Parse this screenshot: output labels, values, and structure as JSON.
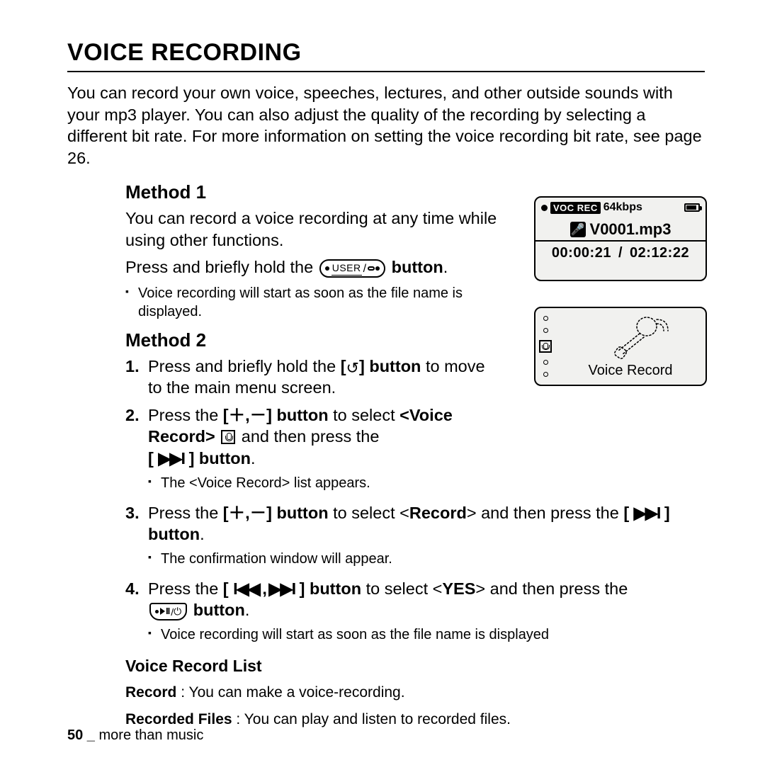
{
  "title": "VOICE RECORDING",
  "intro": "You can record your own voice, speeches, lectures, and other outside sounds with your mp3 player. You can also adjust the quality of the recording by selecting a different bit rate. For more information on setting the voice recording bit rate, see page 26.",
  "method1": {
    "heading": "Method 1",
    "p1": "You can record a voice recording at any time while using other functions.",
    "p2a": "Press and briefly hold the ",
    "p2b": " button",
    "p2c": ".",
    "bullet": "Voice recording will start as soon as the file name is displayed.",
    "user_btn_label": "USER"
  },
  "method2": {
    "heading": "Method 2",
    "s1a": "Press and briefly hold the ",
    "s1b": "[",
    "s1c": "] button",
    "s1d": " to move to the main menu screen.",
    "back_glyph": "↺",
    "s2a": "Press the ",
    "s2b": "[＋,－] button",
    "s2c": " to select ",
    "s2d": "<Voice Record>",
    "s2e": " and then press the ",
    "s2f": "[ ",
    "s2g": " ] button",
    "s2h": ".",
    "ff_glyph": "▶▶I",
    "s2_bullet": "The <Voice Record> list appears.",
    "s3a": "Press the ",
    "s3b": "[＋,－] button",
    "s3c": " to select <",
    "s3d": "Record",
    "s3e": "> and then press the ",
    "s3f": "[ ",
    "s3g": " ] button",
    "s3h": ".",
    "s3_bullet": "The confirmation window will appear.",
    "s4a": "Press the ",
    "s4b": "[ ",
    "s4c": " ] button",
    "prevnext_glyph": "I◀◀ , ▶▶I",
    "s4d": " to select <",
    "s4e": "YES",
    "s4f": "> and then press the ",
    "s4g": " button",
    "s4h": ".",
    "s4_bullet": "Voice recording will start as soon as the file name is displayed"
  },
  "vrlist": {
    "heading": "Voice Record List",
    "i1t": "Record",
    "i1d": " : You can make a voice-recording.",
    "i2t": "Recorded Files",
    "i2d": " : You can play and listen to recorded files."
  },
  "footer": {
    "page": "50",
    "sep": " _ ",
    "section": "more than music"
  },
  "screen1": {
    "voc": "VOC REC",
    "rate": "64kbps",
    "file": "V0001.mp3",
    "elapsed": "00:00:21",
    "sep": "/",
    "total": "02:12:22",
    "mic_glyph": "🎤"
  },
  "screen2": {
    "label": "Voice Record"
  }
}
